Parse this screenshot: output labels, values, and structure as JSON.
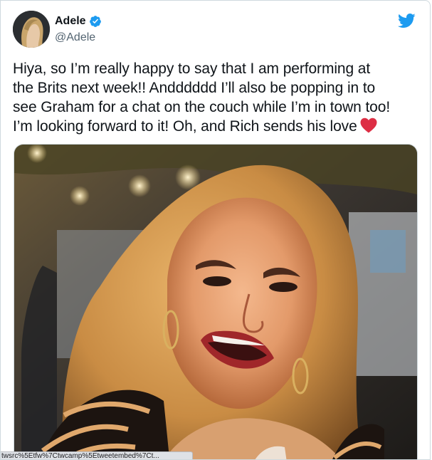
{
  "tweet": {
    "display_name": "Adele",
    "handle": "@Adele",
    "verified": true,
    "verified_icon": "verified-badge-icon",
    "platform_icon": "twitter-bird-icon",
    "brand_color": "#1d9bf0",
    "text_lines": [
      "Hiya, so I’m really happy to say that I am performing at",
      "the Brits next week!! Andddddd I’ll also be popping in to",
      "see Graham for a chat on the couch while I’m in town too!",
      "I’m looking forward to it! Oh, and Rich sends his love"
    ],
    "emoji": "red-heart-icon",
    "media": {
      "type": "photo",
      "subject": "photo"
    }
  },
  "browser": {
    "status_url": "twsrc%5Etfw%7Ctwcamp%5Etweetembed%7Ct..."
  }
}
